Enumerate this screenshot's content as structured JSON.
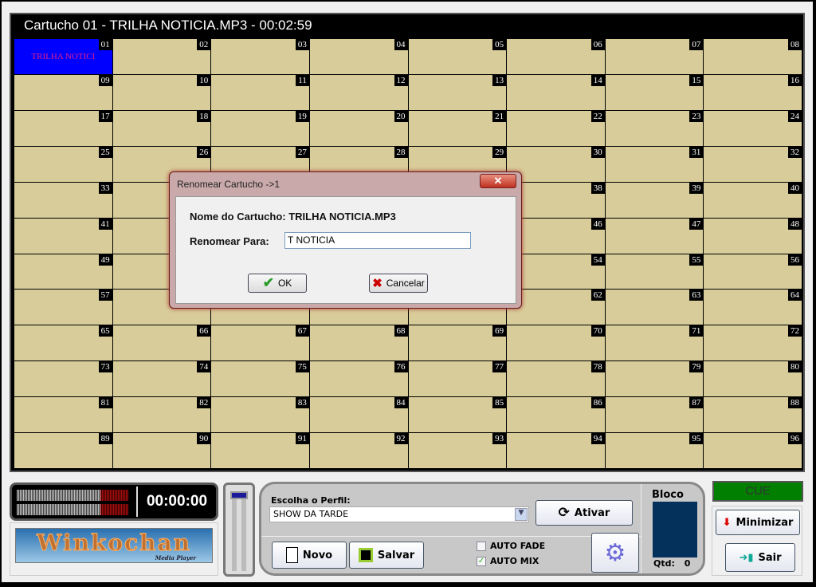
{
  "header": {
    "title": "Cartucho 01 - TRILHA NOTICIA.MP3 - 00:02:59"
  },
  "grid": {
    "active_index": 0,
    "active_color": "#0000ff",
    "cell_color": "#d8cd9a",
    "cells": [
      {
        "num": "01",
        "label": "TRILHA NOTICI"
      }
    ]
  },
  "player": {
    "time": "00:00:00"
  },
  "logo": {
    "text": "Winkochan",
    "tagline": "Media Player"
  },
  "panel": {
    "profile_label": "Escolha o Perfil:",
    "profile_value": "SHOW DA TARDE",
    "ativar": "Ativar",
    "novo": "Novo",
    "salvar": "Salvar",
    "auto_fade": "AUTO FADE",
    "auto_fade_checked": false,
    "auto_mix": "AUTO MIX",
    "auto_mix_checked": true,
    "bloco": "Bloco",
    "qtd_label": "Qtd:",
    "qtd_value": "0"
  },
  "right": {
    "cue": "CUE",
    "minimizar": "Minimizar",
    "sair": "Sair"
  },
  "dialog": {
    "title": "Renomear Cartucho ->1",
    "name_label": "Nome do Cartucho: TRILHA NOTICIA.MP3",
    "rename_label": "Renomear Para:",
    "rename_value": "T NOTICIA",
    "ok": "OK",
    "cancel": "Cancelar"
  }
}
